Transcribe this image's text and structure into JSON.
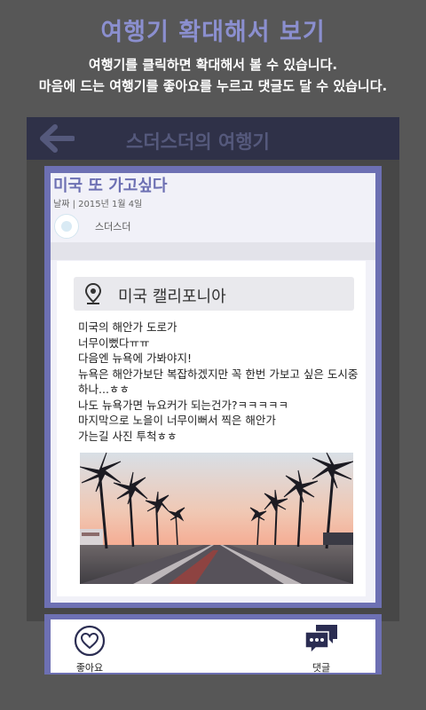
{
  "tutorial": {
    "title": "여행기 확대해서 보기",
    "line1": "여행기를 클릭하면 확대해서 볼 수 있습니다.",
    "line2": "마음에 드는 여행기를 좋아요를 누르고 댓글도 달 수 있습니다."
  },
  "header": {
    "title": "스더스더의 여행기",
    "back_icon": "back-arrow-icon"
  },
  "post": {
    "title": "미국 또 가고싶다",
    "date": "날짜 | 2015년 1월 4일",
    "author": "스더스더",
    "location": "미국 캘리포니아",
    "location_icon": "map-pin-icon",
    "body": "미국의 해안가 도로가\n너무이뻤다ㅠㅠ\n다음엔 뉴욕에 가봐야지!\n뉴욕은 해안가보단 복잡하겠지만 꼭 한번 가보고 싶은 도시중 하나...ㅎㅎ\n나도 뉴욕가면 뉴요커가 되는건가?ㅋㅋㅋㅋㅋ\n마지막으로 노을이 너무이뻐서 찍은 해안가\n가는길 사진 투척ㅎㅎ"
  },
  "actions": {
    "like_label": "좋아요",
    "comment_label": "댓글",
    "like_icon": "heart-icon",
    "comment_icon": "chat-bubbles-icon"
  },
  "colors": {
    "accent": "#6d70b3",
    "title_purple": "#8b8fcf",
    "header_bg": "#2f3148"
  }
}
